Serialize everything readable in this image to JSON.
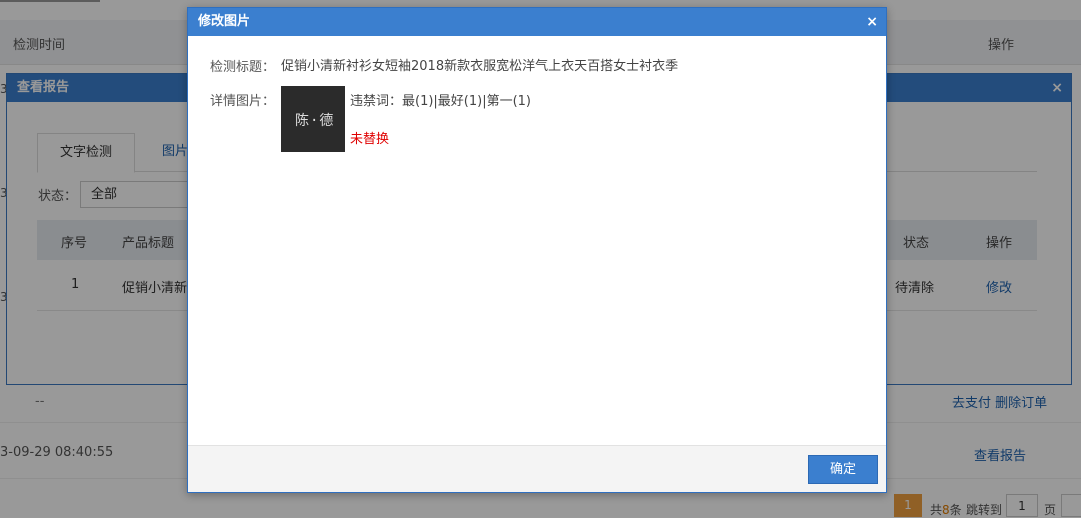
{
  "background": {
    "header": {
      "time_col": "检测时间",
      "op_col": "操作"
    },
    "left_digits": [
      "3",
      "3",
      "3"
    ],
    "row_dash": {
      "placeholder": "--",
      "pay_link": "去支付",
      "delete_link": "删除订单"
    },
    "row_date": {
      "date": "3-09-29 08:40:55",
      "report_link": "查看报告"
    },
    "pager": {
      "current": "1",
      "total_prefix": "共",
      "total_count": "8",
      "total_suffix": "条",
      "jump_label": "跳转到",
      "jump_value": "1",
      "page_label": "页"
    }
  },
  "report_dialog": {
    "title": "查看报告",
    "close": "×",
    "tabs": [
      {
        "label": "文字检测"
      },
      {
        "label": "图片"
      }
    ],
    "filter": {
      "label": "状态：",
      "selected": "全部"
    },
    "table": {
      "headers": [
        "序号",
        "产品标题",
        "状态",
        "操作"
      ],
      "rows": [
        {
          "index": "1",
          "title": "促销小清新",
          "status": "待清除",
          "action": "修改"
        }
      ]
    }
  },
  "modal": {
    "title": "修改图片",
    "close": "×",
    "title_label": "检测标题：",
    "title_value": "促销小清新衬衫女短袖2018新款衣服宽松洋气上衣天百搭女士衬衣季",
    "image_label": "详情图片：",
    "thumb_text": "陈·德",
    "banned_words": "违禁词：最(1)|最好(1)|第一(1)",
    "replace_status": "未替换",
    "confirm": "确定"
  },
  "colors": {
    "titlebar": "#3b7fcf",
    "link": "#1e63b0",
    "warning": "#e00000",
    "pager_active": "#f0a040"
  }
}
